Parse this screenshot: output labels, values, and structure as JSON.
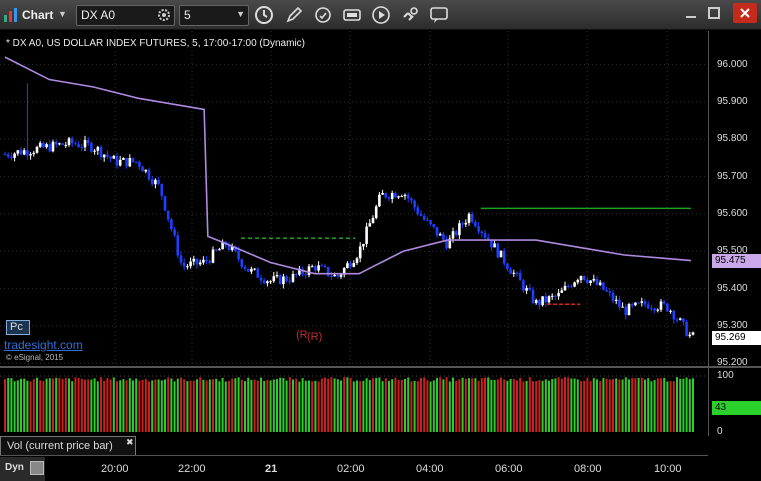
{
  "toolbar": {
    "title": "Chart",
    "symbol": "DX A0",
    "interval": "5",
    "icons": [
      "link-icon",
      "gear-icon",
      "clock-icon",
      "pencil-icon",
      "refresh-icon",
      "settings-icon",
      "play-icon",
      "link-chain-icon",
      "chat-icon"
    ]
  },
  "chart": {
    "caption": "* DX A0, US DOLLAR INDEX FUTURES, 5, 17:00-17:00 (Dynamic)",
    "price_ticks": [
      "96.000",
      "95.900",
      "95.800",
      "95.700",
      "95.600",
      "95.500",
      "95.400",
      "95.300",
      "95.200"
    ],
    "price_badge": "95.475",
    "last_badge": "95.269",
    "vol_ticks": [
      "100",
      "0"
    ],
    "vol_badge": "43",
    "time_ticks": [
      "20:00",
      "22:00",
      "21",
      "02:00",
      "04:00",
      "06:00",
      "08:00",
      "10:00"
    ],
    "pc_label": "Pc",
    "brand": "tradesight.com",
    "copyright": "© eSignal, 2015",
    "annotation_r": "(R",
    "annotation_r2": "(R)",
    "vol_tab": "Vol (current price bar)",
    "vol_tab_close": "✖",
    "dyn": "Dyn",
    "colors": {
      "up": "#ffffff",
      "down": "#1e3fff",
      "ma": "#b08ae0",
      "vol_up": "#2ecc2e",
      "vol_down": "#cc2020",
      "level_green": "#1fa11f",
      "level_red": "#e02020"
    }
  },
  "chart_data": {
    "type": "candlestick",
    "price_ylim": [
      95.19,
      96.09
    ],
    "price_gridlines": [
      96.0,
      95.9,
      95.8,
      95.7,
      95.6,
      95.5,
      95.4,
      95.3,
      95.2
    ],
    "moving_average": {
      "x": [
        "19:00",
        "20:00",
        "21:00",
        "22:00",
        "23:00",
        "23:30",
        "23:35",
        "00:00",
        "01:00",
        "02:00",
        "03:00",
        "04:00",
        "05:00",
        "06:00",
        "07:00",
        "08:00",
        "09:00",
        "10:00",
        "10:30"
      ],
      "y": [
        96.02,
        95.96,
        95.94,
        95.91,
        95.89,
        95.88,
        95.54,
        95.52,
        95.47,
        95.44,
        95.44,
        95.5,
        95.53,
        95.53,
        95.53,
        95.51,
        95.49,
        95.48,
        95.475
      ]
    },
    "candles_approx": {
      "x": [
        "19:00",
        "19:30",
        "20:00",
        "20:30",
        "21:00",
        "21:30",
        "22:00",
        "22:30",
        "23:00",
        "23:30",
        "00:00",
        "00:30",
        "01:00",
        "01:30",
        "02:00",
        "02:30",
        "03:00",
        "03:30",
        "04:00",
        "04:30",
        "05:00",
        "05:30",
        "06:00",
        "06:30",
        "07:00",
        "07:30",
        "08:00",
        "08:30",
        "09:00",
        "09:30",
        "10:00",
        "10:30"
      ],
      "close": [
        95.76,
        95.77,
        95.78,
        95.79,
        95.78,
        95.74,
        95.74,
        95.67,
        95.46,
        95.47,
        95.52,
        95.45,
        95.42,
        95.43,
        95.46,
        95.43,
        95.5,
        95.65,
        95.66,
        95.58,
        95.52,
        95.6,
        95.52,
        95.44,
        95.36,
        95.38,
        95.44,
        95.4,
        95.34,
        95.36,
        95.35,
        95.27
      ]
    },
    "green_level": {
      "price": 95.615,
      "x": [
        "05:45",
        "10:30"
      ]
    },
    "dashed_green_level": {
      "price": 95.535,
      "x": [
        "00:20",
        "02:55"
      ]
    },
    "red_level": {
      "price": 95.358,
      "x": [
        "07:15",
        "08:00"
      ]
    },
    "vol_ylim": [
      0,
      100
    ]
  }
}
